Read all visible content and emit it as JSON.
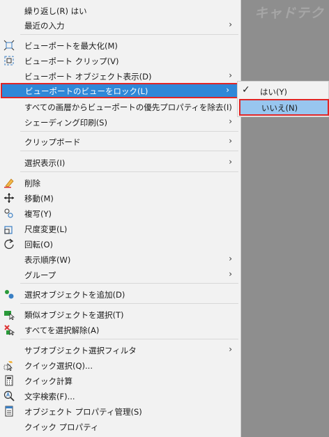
{
  "colors": {
    "highlight": "#2f88d8",
    "highlight_border": "#e02525",
    "sub_highlight": "#98c6ef"
  },
  "background_logo": "キャドテク",
  "menu": {
    "items": [
      {
        "label": "繰り返し(R) はい",
        "icon": "",
        "arrow": ""
      },
      {
        "label": "最近の入力",
        "icon": "",
        "arrow": "›"
      },
      {
        "label": "ビューポートを最大化(M)",
        "icon": "maximize-viewport-icon",
        "arrow": ""
      },
      {
        "label": "ビューポート クリップ(V)",
        "icon": "clip-viewport-icon",
        "arrow": ""
      },
      {
        "label": "ビューポート オブジェクト表示(D)",
        "icon": "",
        "arrow": "›"
      },
      {
        "label": "ビューポートのビューをロック(L)",
        "icon": "",
        "arrow": "›"
      },
      {
        "label": "すべての画層からビューポートの優先プロパティを除去(I)",
        "icon": "",
        "arrow": ""
      },
      {
        "label": "シェーディング印刷(S)",
        "icon": "",
        "arrow": "›"
      },
      {
        "label": "クリップボード",
        "icon": "",
        "arrow": "›"
      },
      {
        "label": "選択表示(I)",
        "icon": "",
        "arrow": "›"
      },
      {
        "label": "削除",
        "icon": "erase-icon",
        "arrow": ""
      },
      {
        "label": "移動(M)",
        "icon": "move-icon",
        "arrow": ""
      },
      {
        "label": "複写(Y)",
        "icon": "copy-icon",
        "arrow": ""
      },
      {
        "label": "尺度変更(L)",
        "icon": "scale-icon",
        "arrow": ""
      },
      {
        "label": "回転(O)",
        "icon": "rotate-icon",
        "arrow": ""
      },
      {
        "label": "表示順序(W)",
        "icon": "",
        "arrow": "›"
      },
      {
        "label": "グループ",
        "icon": "",
        "arrow": "›"
      },
      {
        "label": "選択オブジェクトを追加(D)",
        "icon": "add-selected-icon",
        "arrow": ""
      },
      {
        "label": "類似オブジェクトを選択(T)",
        "icon": "select-similar-icon",
        "arrow": ""
      },
      {
        "label": "すべてを選択解除(A)",
        "icon": "deselect-all-icon",
        "arrow": ""
      },
      {
        "label": "サブオブジェクト選択フィルタ",
        "icon": "",
        "arrow": "›"
      },
      {
        "label": "クイック選択(Q)...",
        "icon": "quick-select-icon",
        "arrow": ""
      },
      {
        "label": "クイック計算",
        "icon": "calculator-icon",
        "arrow": ""
      },
      {
        "label": "文字検索(F)...",
        "icon": "find-text-icon",
        "arrow": ""
      },
      {
        "label": "オブジェクト プロパティ管理(S)",
        "icon": "properties-icon",
        "arrow": ""
      },
      {
        "label": "クイック プロパティ",
        "icon": "",
        "arrow": ""
      }
    ]
  },
  "submenu": {
    "items": [
      {
        "label": "はい(Y)",
        "check": "✓"
      },
      {
        "label": "いいえ(N)",
        "check": ""
      }
    ]
  }
}
